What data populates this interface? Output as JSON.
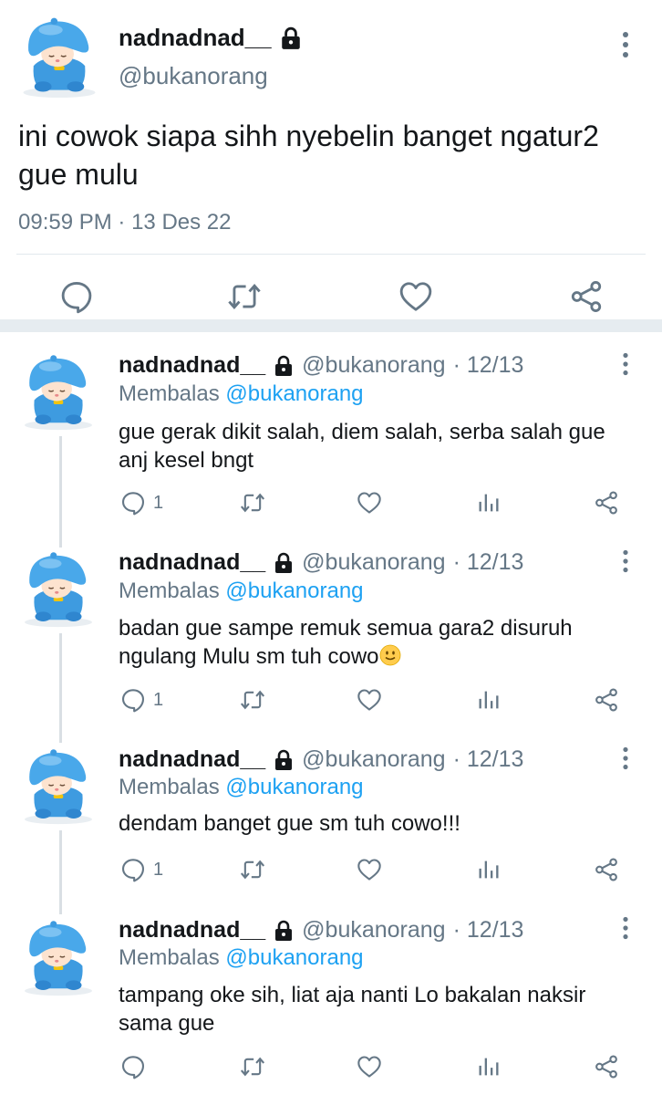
{
  "main_tweet": {
    "display_name": "nadnadnad__",
    "handle": "@bukanorang",
    "text": "ini cowok siapa sihh nyebelin banget ngatur2 gue mulu",
    "time": "09:59 PM",
    "separator": "·",
    "date": "13 Des 22",
    "icons": [
      "reply-icon",
      "retweet-icon",
      "like-icon",
      "share-icon"
    ]
  },
  "replies": [
    {
      "display_name": "nadnadnad__",
      "handle": "@bukanorang",
      "date": "· 12/13",
      "reply_label": "Membalas",
      "reply_to": "@bukanorang",
      "text": "gue gerak dikit salah, diem salah, serba salah gue anj kesel bngt",
      "reply_count": "1"
    },
    {
      "display_name": "nadnadnad__",
      "handle": "@bukanorang",
      "date": "· 12/13",
      "reply_label": "Membalas",
      "reply_to": "@bukanorang",
      "text": "badan gue sampe remuk semua gara2 disuruh ngulang Mulu sm tuh cowo",
      "emoji": "slightly-smiling-face",
      "reply_count": "1"
    },
    {
      "display_name": "nadnadnad__",
      "handle": "@bukanorang",
      "date": "· 12/13",
      "reply_label": "Membalas",
      "reply_to": "@bukanorang",
      "text": "dendam banget gue sm tuh cowo!!!",
      "reply_count": "1"
    },
    {
      "display_name": "nadnadnad__",
      "handle": "@bukanorang",
      "date": "· 12/13",
      "reply_label": "Membalas",
      "reply_to": "@bukanorang",
      "text": "tampang oke sih, liat aja nanti Lo bakalan naksir sama gue",
      "reply_count": ""
    }
  ],
  "colors": {
    "link": "#1da1f2",
    "secondary_text": "#657786",
    "primary_text": "#14171a",
    "avatar_blue": "#3e9be0"
  }
}
